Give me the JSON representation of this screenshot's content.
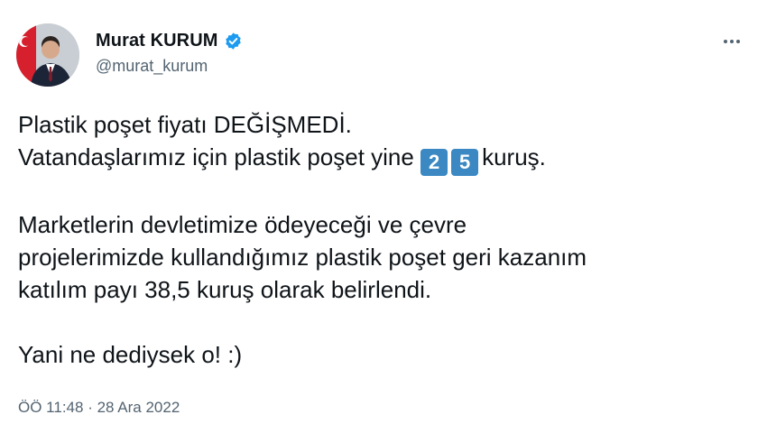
{
  "author": {
    "display_name": "Murat KURUM",
    "handle": "@murat_kurum",
    "verified": true
  },
  "icons": {
    "verified": "verified-badge-icon",
    "more": "more-options-icon"
  },
  "colors": {
    "verified": "#1d9bf0",
    "keycap": "#3b88c3",
    "secondary_text": "#536471"
  },
  "tweet": {
    "line1": "Plastik poşet fiyatı DEĞİŞMEDİ.",
    "line2_before": "Vatandaşlarımız için plastik poşet yine",
    "keycap_1": "2",
    "keycap_2": "5",
    "line2_after": "kuruş.",
    "para2_line1": "Marketlerin devletimize ödeyeceği ve çevre",
    "para2_line2": "projelerimizde kullandığımız plastik poşet geri kazanım",
    "para2_line3": "katılım payı 38,5 kuruş olarak belirlendi.",
    "para3": "Yani ne dediysek o! :)"
  },
  "meta": {
    "time": "ÖÖ 11:48",
    "separator": "·",
    "date": "28 Ara 2022"
  }
}
